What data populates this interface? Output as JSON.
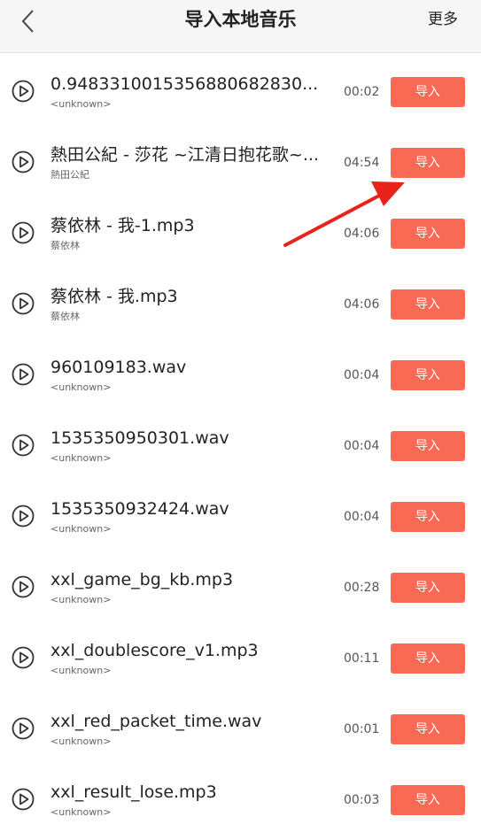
{
  "header": {
    "title": "导入本地音乐",
    "more_label": "更多"
  },
  "songs": [
    {
      "title": "0.9483310015356880682830...",
      "artist": "<unknown>",
      "duration": "00:02",
      "action": "导入"
    },
    {
      "title": "熱田公紀 - 莎花 ~江清日抱花歌~...",
      "artist": "熱田公紀",
      "duration": "04:54",
      "action": "导入"
    },
    {
      "title": "蔡依林 - 我-1.mp3",
      "artist": "蔡依林",
      "duration": "04:06",
      "action": "导入"
    },
    {
      "title": "蔡依林 - 我.mp3",
      "artist": "蔡依林",
      "duration": "04:06",
      "action": "导入"
    },
    {
      "title": "960109183.wav",
      "artist": "<unknown>",
      "duration": "00:04",
      "action": "导入"
    },
    {
      "title": "1535350950301.wav",
      "artist": "<unknown>",
      "duration": "00:04",
      "action": "导入"
    },
    {
      "title": "1535350932424.wav",
      "artist": "<unknown>",
      "duration": "00:04",
      "action": "导入"
    },
    {
      "title": "xxl_game_bg_kb.mp3",
      "artist": "<unknown>",
      "duration": "00:28",
      "action": "导入"
    },
    {
      "title": "xxl_doublescore_v1.mp3",
      "artist": "<unknown>",
      "duration": "00:11",
      "action": "导入"
    },
    {
      "title": "xxl_red_packet_time.wav",
      "artist": "<unknown>",
      "duration": "00:01",
      "action": "导入"
    },
    {
      "title": "xxl_result_lose.mp3",
      "artist": "<unknown>",
      "duration": "00:03",
      "action": "导入"
    }
  ],
  "colors": {
    "import_button": "#f86a53",
    "annotation_arrow": "#e8231b"
  },
  "icons": {
    "back": "chevron-left-icon",
    "play": "play-circle-icon"
  }
}
